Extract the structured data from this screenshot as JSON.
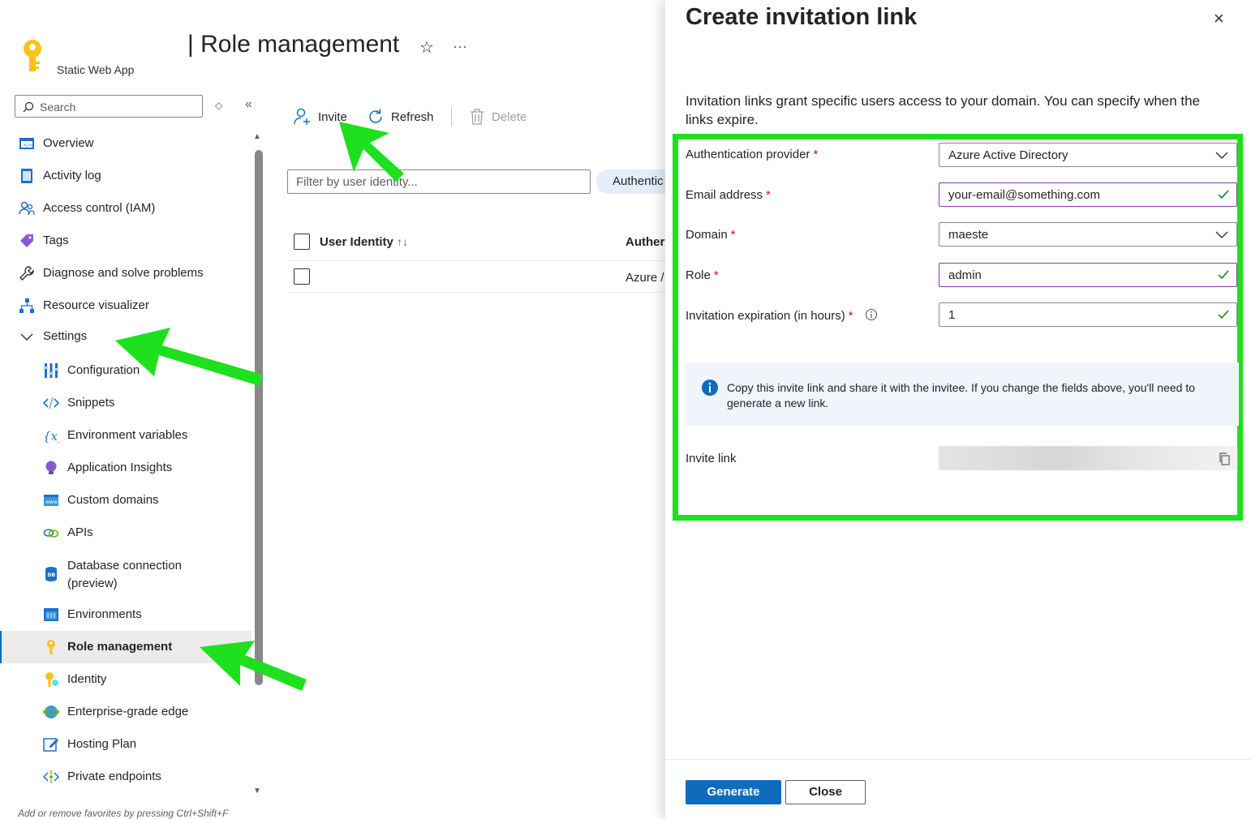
{
  "header": {
    "title": "| Role management",
    "subtitle": "Static Web App",
    "favorite_icon": "star-icon",
    "more_icon": "ellipsis-icon"
  },
  "sidebar": {
    "search_placeholder": "Search",
    "items": [
      {
        "label": "Overview",
        "icon": "overview-icon"
      },
      {
        "label": "Activity log",
        "icon": "activity-log-icon"
      },
      {
        "label": "Access control (IAM)",
        "icon": "people-icon"
      },
      {
        "label": "Tags",
        "icon": "tag-icon"
      },
      {
        "label": "Diagnose and solve problems",
        "icon": "wrench-icon"
      },
      {
        "label": "Resource visualizer",
        "icon": "hierarchy-icon"
      },
      {
        "label": "Settings",
        "icon": "chevron-down-icon"
      },
      {
        "label": "Configuration",
        "icon": "sliders-icon"
      },
      {
        "label": "Snippets",
        "icon": "code-icon"
      },
      {
        "label": "Environment variables",
        "icon": "variable-icon"
      },
      {
        "label": "Application Insights",
        "icon": "lightbulb-icon"
      },
      {
        "label": "Custom domains",
        "icon": "www-icon"
      },
      {
        "label": "APIs",
        "icon": "link-icon"
      },
      {
        "label": "Database connection (preview)",
        "icon": "database-icon"
      },
      {
        "label": "Environments",
        "icon": "environments-icon"
      },
      {
        "label": "Role management",
        "icon": "key-icon"
      },
      {
        "label": "Identity",
        "icon": "identity-key-icon"
      },
      {
        "label": "Enterprise-grade edge",
        "icon": "globe-icon"
      },
      {
        "label": "Hosting Plan",
        "icon": "edit-plan-icon"
      },
      {
        "label": "Private endpoints",
        "icon": "endpoint-icon"
      }
    ],
    "footer_hint": "Add or remove favorites by pressing Ctrl+Shift+F"
  },
  "toolbar": {
    "invite_label": "Invite",
    "refresh_label": "Refresh",
    "delete_label": "Delete"
  },
  "main": {
    "filter_placeholder": "Filter by user identity...",
    "filter_pill": "Authentic",
    "columns": [
      "User Identity",
      "Auther"
    ],
    "rows": [
      {
        "identity": "",
        "provider": "Azure /"
      }
    ]
  },
  "panel": {
    "title": "Create invitation link",
    "description": "Invitation links grant specific users access to your domain. You can specify when the links expire.",
    "fields": {
      "provider": {
        "label": "Authentication provider",
        "value": "Azure Active Directory"
      },
      "email": {
        "label": "Email address",
        "value": "your-email@something.com"
      },
      "domain": {
        "label": "Domain",
        "value": "maeste"
      },
      "role": {
        "label": "Role",
        "value": "admin"
      },
      "expiration": {
        "label": "Invitation expiration (in hours)",
        "value": "1"
      }
    },
    "required_mark": "*",
    "info_message": "Copy this invite link and share it with the invitee. If you change the fields above, you'll need to generate a new link.",
    "invite_link_label": "Invite link",
    "generate_label": "Generate",
    "close_label": "Close",
    "close_icon": "×"
  },
  "colors": {
    "accent": "#0f6cbd",
    "highlight": "#1ee01e",
    "required": "#c50f1f",
    "valid_check": "#107c10"
  }
}
